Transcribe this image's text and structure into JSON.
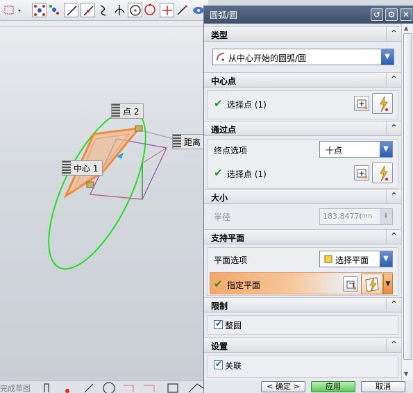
{
  "dialog": {
    "title": "圆弧/圆",
    "sections": {
      "type": {
        "header": "类型",
        "selected": "从中心开始的圆弧/圆"
      },
      "center": {
        "header": "中心点",
        "select_label": "选择点 (1)"
      },
      "through": {
        "header": "通过点",
        "endpoint_option_label": "终点选项",
        "endpoint_option_value": "十点",
        "select_label": "选择点 (1)"
      },
      "size": {
        "header": "大小",
        "radius_label": "半径",
        "radius_value": "183.8477(",
        "radius_unit": "mm"
      },
      "support_plane": {
        "header": "支持平面",
        "plane_option_label": "平面选项",
        "plane_option_value": "选择平面",
        "specify_label": "指定平面"
      },
      "limits": {
        "header": "限制",
        "full_circle_label": "整圆",
        "full_circle_checked": true
      },
      "settings": {
        "header": "设置",
        "associative_label": "关联",
        "associative_checked": true
      }
    },
    "buttons": {
      "ok": "< 确定 >",
      "apply": "应用",
      "cancel": "取消"
    }
  },
  "viewport": {
    "labels": {
      "point2": "点 2",
      "distance": "距离",
      "center1": "中心 1"
    }
  },
  "status": {
    "hint": "完成草图"
  },
  "colors": {
    "accent_orange": "#f08a3c",
    "circle_green": "#22e022",
    "check_green": "#1e9a1e",
    "titlebar": "#4a5d78",
    "dropdown_blue": "#2e5db3",
    "apply_green": "#5cc85c"
  }
}
